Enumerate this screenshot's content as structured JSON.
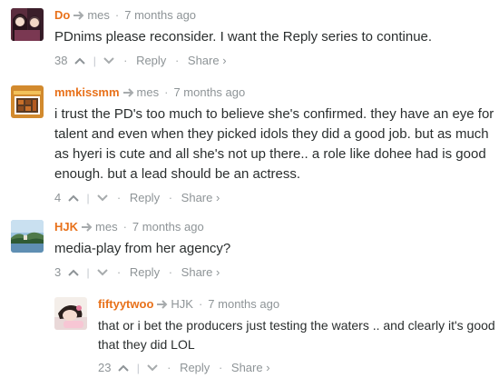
{
  "comments": [
    {
      "author": "Do",
      "reply_to": "mes",
      "time": "7 months ago",
      "text": "PDnims please reconsider. I want the Reply series to continue.",
      "votes": "38",
      "reply_label": "Reply",
      "share_label": "Share ›",
      "avatar": "woman-portrait-avatar"
    },
    {
      "author": "mmkissmm",
      "reply_to": "mes",
      "time": "7 months ago",
      "text": "i trust the PD's too much to believe she's confirmed. they have an eye for talent and even when they picked idols they did a good job. but as much as hyeri is cute and all she's not up there.. a role like dohee had is good enough. but a lead should be an actress.",
      "votes": "4",
      "reply_label": "Reply",
      "share_label": "Share ›",
      "avatar": "board-game-avatar"
    },
    {
      "author": "HJK",
      "reply_to": "mes",
      "time": "7 months ago",
      "text": "media-play from her agency?",
      "votes": "3",
      "reply_label": "Reply",
      "share_label": "Share ›",
      "avatar": "landscape-avatar"
    },
    {
      "author": "fiftyytwoo",
      "reply_to": "HJK",
      "time": "7 months ago",
      "text": "that or i bet the producers just testing the waters .. and clearly it's good that they did LOL",
      "votes": "23",
      "reply_label": "Reply",
      "share_label": "Share ›",
      "avatar": "sleeping-girl-avatar"
    }
  ],
  "colors": {
    "author": "#e8711a",
    "meta": "#8e9497",
    "text": "#2a2e2e"
  },
  "separator": "·"
}
